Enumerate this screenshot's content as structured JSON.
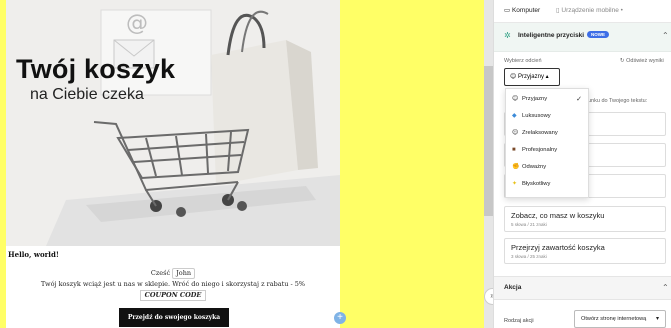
{
  "email": {
    "hero_title": "Twój koszyk",
    "hero_subtitle": "na Ciebie czeka",
    "greeting": "Hello, world!",
    "line1_prefix": "Cześć",
    "line1_name": "John",
    "line2": "Twój koszyk wciąż jest u nas w sklepie. Wróć do niego i skorzystaj z rabatu - 5%",
    "coupon": "COUPON CODE",
    "cta": "Przejdź do swojego koszyka",
    "plus_icon": "plus-icon"
  },
  "panel": {
    "tabs": [
      {
        "label": "Komputer",
        "icon": "monitor-icon"
      },
      {
        "label": "Urządzenie mobilne",
        "icon": "phone-icon"
      }
    ],
    "smart_buttons": {
      "title": "Inteligentne przyciski",
      "badge": "NOWE",
      "tone_label": "Wybierz odcień",
      "refresh_label": "Odśwież wyniki",
      "selected_tone": "Przyjazny",
      "hint_fragment": "unku do Twojego tekstu:",
      "tones": [
        {
          "label": "Przyjazny",
          "icon": "smile-emoji",
          "selected": true
        },
        {
          "label": "Luksusowy",
          "icon": "diamond-emoji",
          "selected": false
        },
        {
          "label": "Zrelaksowany",
          "icon": "relaxed-emoji",
          "selected": false
        },
        {
          "label": "Profesjonalny",
          "icon": "briefcase-emoji",
          "selected": false
        },
        {
          "label": "Odważny",
          "icon": "flex-emoji",
          "selected": false
        },
        {
          "label": "Błyskotliwy",
          "icon": "lightbulb-emoji",
          "selected": false
        }
      ],
      "suggestions": [
        {
          "title": "Zobacz, co masz w koszyku",
          "meta": "5 słowa / 21 znaki"
        },
        {
          "title": "Przejrzyj zawartość koszyka",
          "meta": "3 słowa / 25 znaki"
        }
      ]
    },
    "action": {
      "title": "Akcja",
      "type_label": "Rodzaj akcji",
      "type_value": "Otwórz stronę internetową"
    }
  },
  "colors": {
    "canvas_bg": "#ffff66",
    "accent": "#3d6ee6",
    "section_tint": "#f0f6f3",
    "cta_bg": "#111111"
  }
}
